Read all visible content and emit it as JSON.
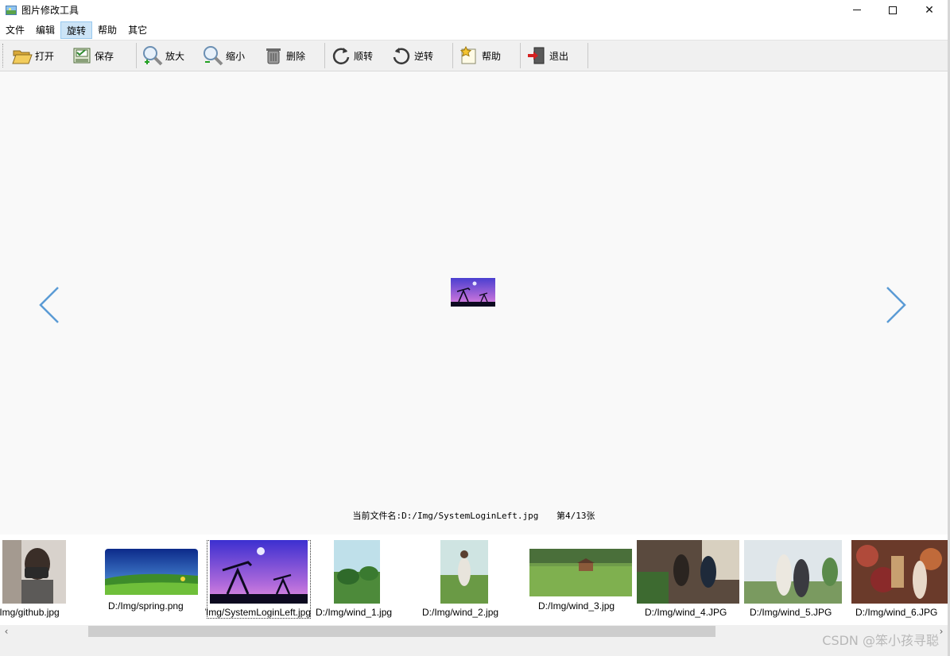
{
  "window": {
    "title": "图片修改工具",
    "minimize": "—",
    "maximize": "☐",
    "close": "✕"
  },
  "menu": [
    "文件",
    "编辑",
    "旋转",
    "帮助",
    "其它"
  ],
  "menu_active_index": 2,
  "toolbar": {
    "open": "打开",
    "save": "保存",
    "zoom_in": "放大",
    "zoom_out": "缩小",
    "delete": "删除",
    "rotate_cw": "顺转",
    "rotate_ccw": "逆转",
    "help": "帮助",
    "exit": "退出"
  },
  "viewer": {
    "filename_label": "当前文件名:D:/Img/SystemLoginLeft.jpg",
    "page_label": "第4/13张",
    "prev_icon": "chevron-left-icon",
    "next_icon": "chevron-right-icon"
  },
  "thumbnails": [
    {
      "caption": "D:/Img/github.jpg"
    },
    {
      "caption": "D:/Img/spring.png"
    },
    {
      "caption": "D:/Img/SystemLoginLeft.jpg",
      "selected": true
    },
    {
      "caption": "D:/Img/wind_1.jpg"
    },
    {
      "caption": "D:/Img/wind_2.jpg"
    },
    {
      "caption": "D:/Img/wind_3.jpg"
    },
    {
      "caption": "D:/Img/wind_4.JPG"
    },
    {
      "caption": "D:/Img/wind_5.JPG"
    },
    {
      "caption": "D:/Img/wind_6.JPG"
    }
  ],
  "scrollbar": {
    "left": "‹",
    "right": "›"
  },
  "watermark": "CSDN @笨小孩寻聪",
  "colors": {
    "accent": "#5b9bd5",
    "menu_highlight": "#cce4f7"
  }
}
